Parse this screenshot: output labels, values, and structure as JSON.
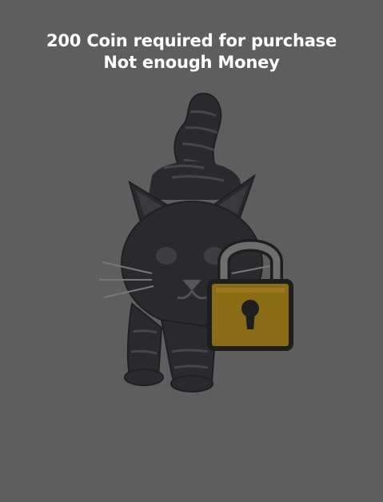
{
  "overlay": {
    "line1": "200 Coin required for purchase",
    "line2": "Not enough Money"
  },
  "item": {
    "image_icon": "black-cat-icon",
    "lock_icon": "padlock-icon",
    "state": "locked"
  },
  "colors": {
    "overlay_background": "#5e5e5e",
    "text": "#ffffff",
    "cat_body": "#2a2a2e",
    "cat_stripes": "#4a4a4e",
    "lock_body": "#8a6b16",
    "lock_shackle": "#6e6e6e",
    "lock_outline": "#1e1e1e"
  }
}
